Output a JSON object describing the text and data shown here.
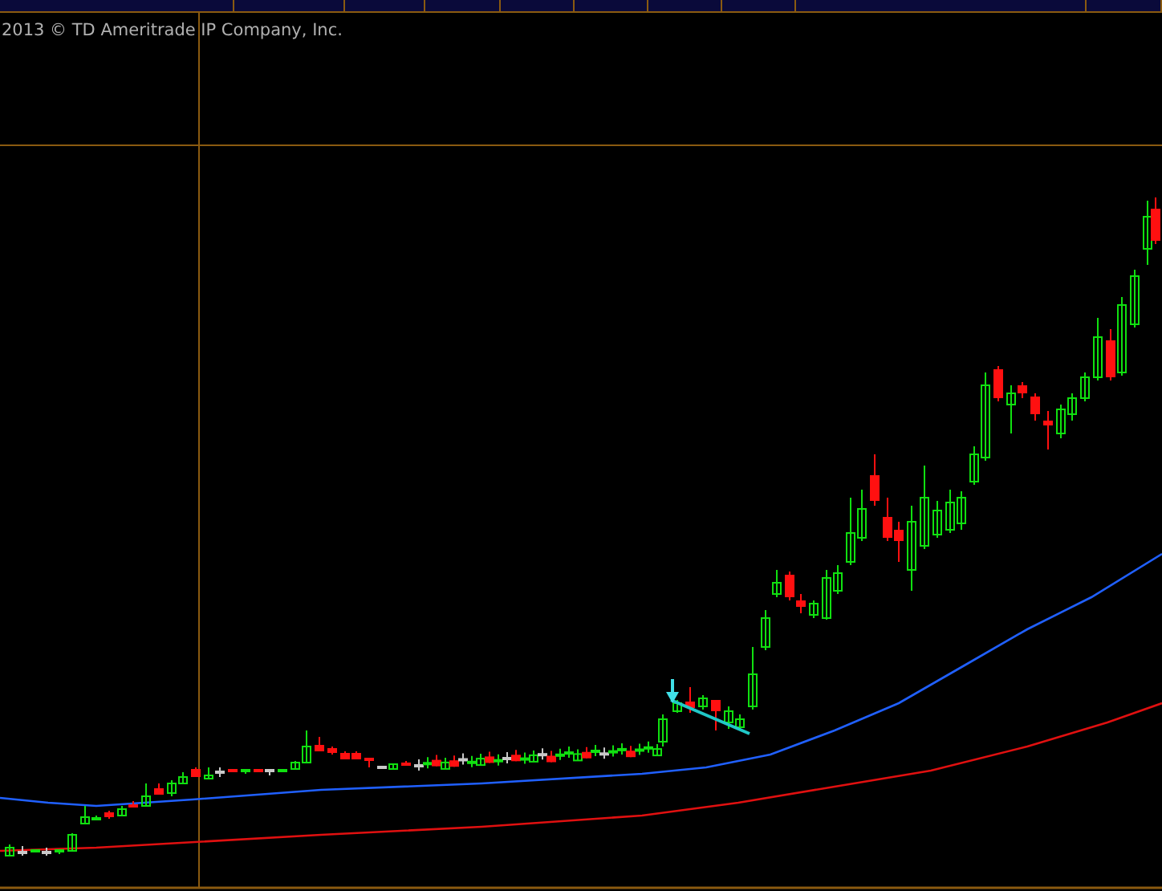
{
  "chart": {
    "copyright": "2013 © TD Ameritrade IP Company, Inc."
  }
}
